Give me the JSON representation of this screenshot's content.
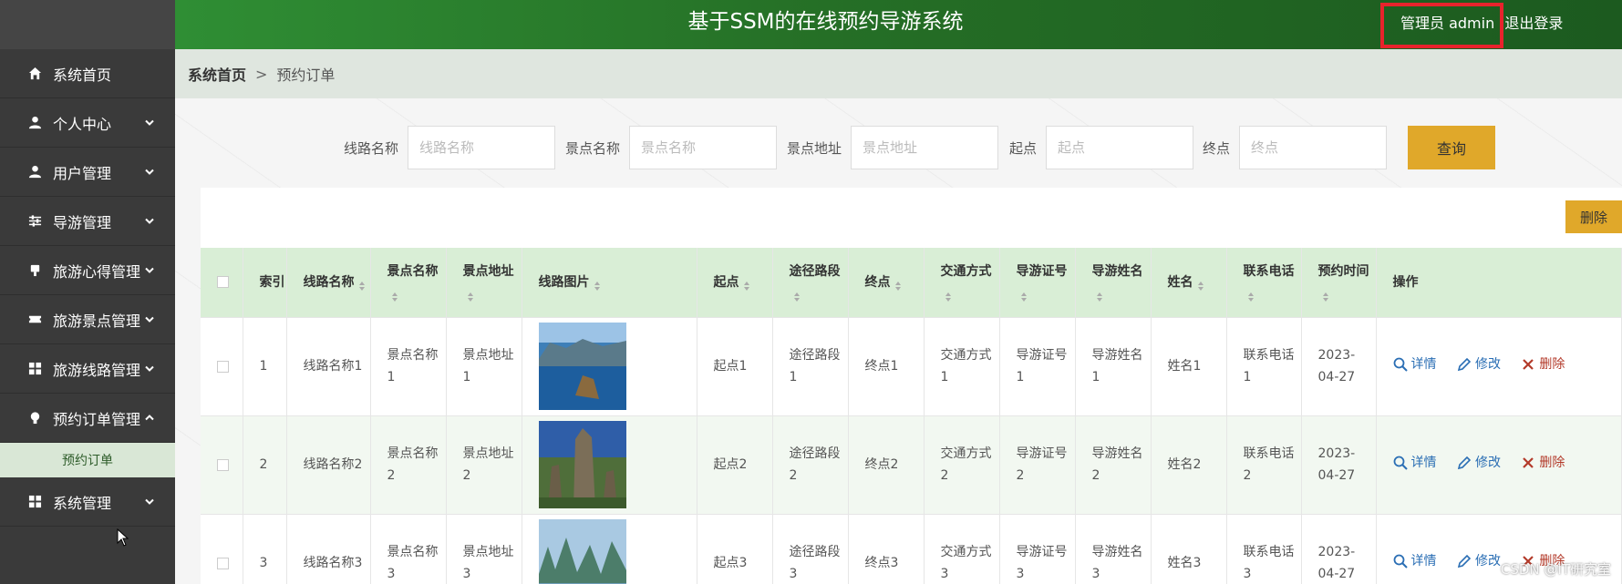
{
  "header": {
    "title": "基于SSM的在线预约导游系统",
    "user_label": "管理员 admin",
    "logout_label": "退出登录"
  },
  "sidebar": {
    "items": [
      {
        "label": "系统首页",
        "icon": "home-icon"
      },
      {
        "label": "个人中心",
        "icon": "user-icon"
      },
      {
        "label": "用户管理",
        "icon": "user-icon"
      },
      {
        "label": "导游管理",
        "icon": "sliders-icon"
      },
      {
        "label": "旅游心得管理",
        "icon": "thumbs-up-icon"
      },
      {
        "label": "旅游景点管理",
        "icon": "ticket-icon"
      },
      {
        "label": "旅游线路管理",
        "icon": "grid-icon"
      },
      {
        "label": "预约订单管理",
        "icon": "bulb-icon"
      },
      {
        "label": "系统管理",
        "icon": "grid-icon"
      }
    ],
    "active_sub": "预约订单"
  },
  "breadcrumb": {
    "home": "系统首页",
    "sep": ">",
    "current": "预约订单"
  },
  "search": {
    "fields": [
      {
        "label": "线路名称",
        "placeholder": "线路名称"
      },
      {
        "label": "景点名称",
        "placeholder": "景点名称"
      },
      {
        "label": "景点地址",
        "placeholder": "景点地址"
      },
      {
        "label": "起点",
        "placeholder": "起点"
      },
      {
        "label": "终点",
        "placeholder": "终点"
      }
    ],
    "button_label": "查询"
  },
  "toolbar": {
    "delete_label": "删除"
  },
  "table": {
    "columns": [
      {
        "label": "",
        "sortable": false
      },
      {
        "label": "索引",
        "sortable": false
      },
      {
        "label": "线路名称",
        "sortable": true
      },
      {
        "label": "景点名称",
        "sortable": true
      },
      {
        "label": "景点地址",
        "sortable": true
      },
      {
        "label": "线路图片",
        "sortable": true
      },
      {
        "label": "起点",
        "sortable": true
      },
      {
        "label": "途径路段",
        "sortable": true
      },
      {
        "label": "终点",
        "sortable": true
      },
      {
        "label": "交通方式",
        "sortable": true
      },
      {
        "label": "导游证号",
        "sortable": true
      },
      {
        "label": "导游姓名",
        "sortable": true
      },
      {
        "label": "姓名",
        "sortable": true
      },
      {
        "label": "联系电话",
        "sortable": true
      },
      {
        "label": "预约时间",
        "sortable": true
      },
      {
        "label": "操作",
        "sortable": false
      }
    ],
    "rows": [
      {
        "index": "1",
        "route": "线路名称1",
        "spot": "景点名称1",
        "addr": "景点地址1",
        "start": "起点1",
        "via": "途径路段1",
        "end": "终点1",
        "transport": "交通方式1",
        "guide_no": "导游证号1",
        "guide_name": "导游姓名1",
        "name": "姓名1",
        "phone": "联系电话1",
        "time": "2023-04-27"
      },
      {
        "index": "2",
        "route": "线路名称2",
        "spot": "景点名称2",
        "addr": "景点地址2",
        "start": "起点2",
        "via": "途径路段2",
        "end": "终点2",
        "transport": "交通方式2",
        "guide_no": "导游证号2",
        "guide_name": "导游姓名2",
        "name": "姓名2",
        "phone": "联系电话2",
        "time": "2023-04-27"
      },
      {
        "index": "3",
        "route": "线路名称3",
        "spot": "景点名称3",
        "addr": "景点地址3",
        "start": "起点3",
        "via": "途径路段3",
        "end": "终点3",
        "transport": "交通方式3",
        "guide_no": "导游证号3",
        "guide_name": "导游姓名3",
        "name": "姓名3",
        "phone": "联系电话3",
        "time": "2023-04-27"
      }
    ],
    "actions": {
      "detail": "详情",
      "edit": "修改",
      "delete": "删除"
    }
  },
  "watermark": "CSDN @IT研究室",
  "colors": {
    "header_green": "#2f8e34",
    "accent_gold": "#e0a82a",
    "sidebar_bg": "#3a3a3a",
    "highlight_red": "#e8232c"
  }
}
